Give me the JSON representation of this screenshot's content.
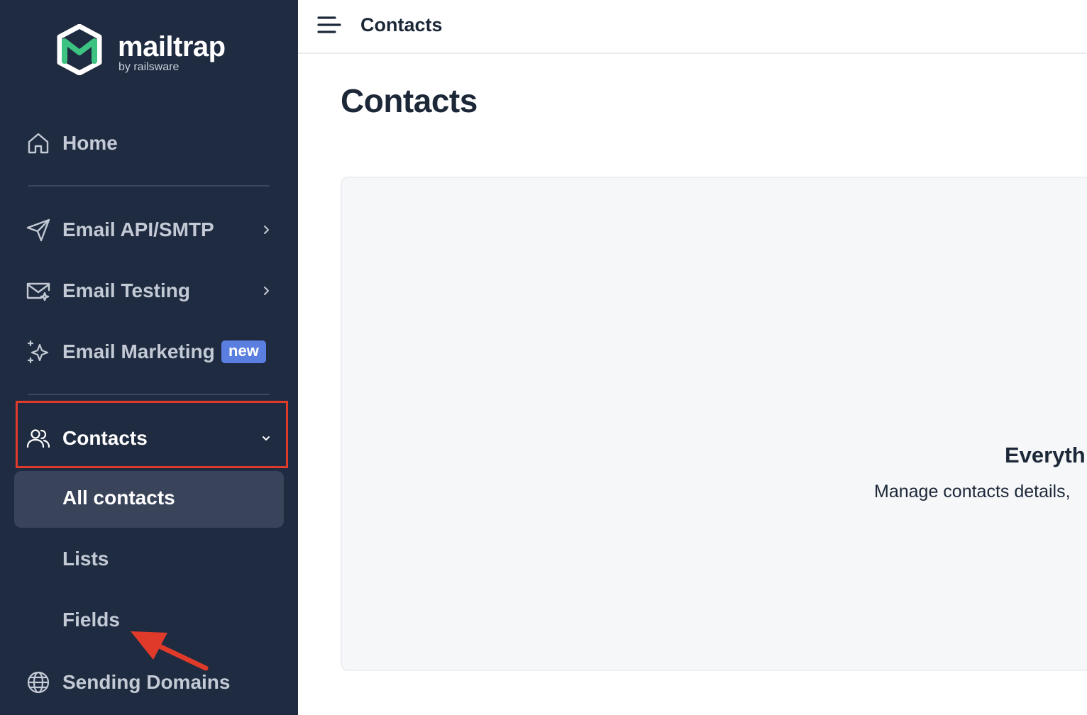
{
  "brand": {
    "name": "mailtrap",
    "sub": "by railsware",
    "accent": "#3cc281"
  },
  "sidebar": {
    "items": [
      {
        "label": "Home",
        "icon": "home-icon"
      },
      {
        "label": "Email API/SMTP",
        "icon": "send-icon"
      },
      {
        "label": "Email Testing",
        "icon": "mail-check-icon"
      },
      {
        "label": "Email Marketing",
        "icon": "sparkles-icon",
        "badge": "new"
      },
      {
        "label": "Contacts",
        "icon": "users-icon",
        "expanded": true
      },
      {
        "label": "Sending Domains",
        "icon": "globe-icon"
      }
    ],
    "contacts_sub": [
      {
        "label": "All contacts",
        "active": true
      },
      {
        "label": "Lists"
      },
      {
        "label": "Fields"
      }
    ]
  },
  "topbar": {
    "title": "Contacts"
  },
  "main": {
    "title": "Contacts",
    "empty_title": "Everyth",
    "empty_desc": "Manage contacts details,"
  },
  "colors": {
    "sidebar_bg": "#1f2b40",
    "highlight": "#e03a2a",
    "badge": "#5a7fe0"
  }
}
